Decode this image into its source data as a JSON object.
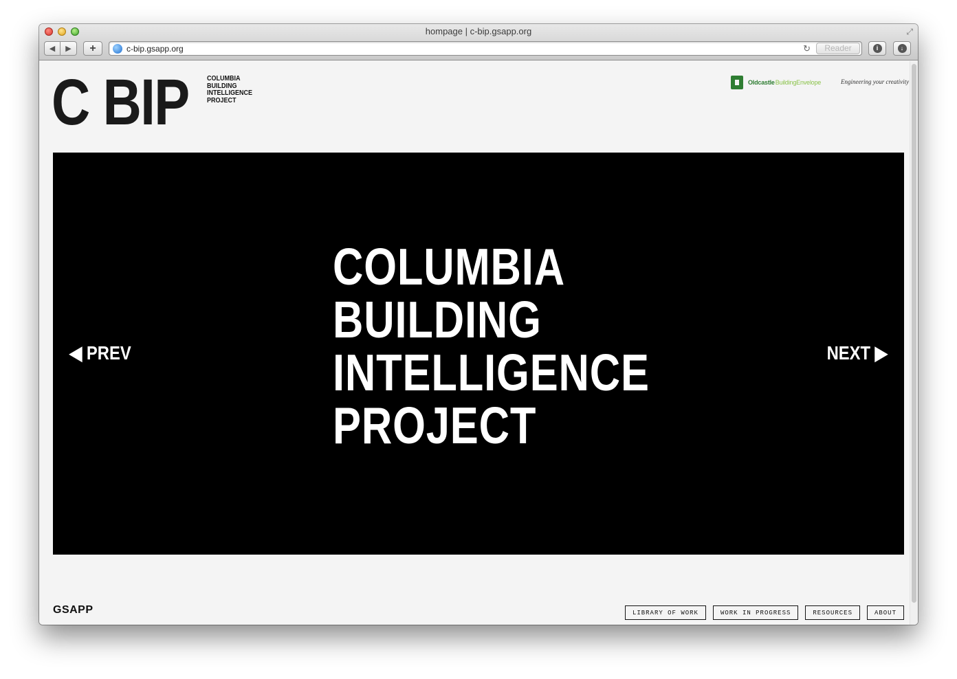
{
  "window": {
    "title": "hompage | c-bip.gsapp.org",
    "url": "c-bip.gsapp.org",
    "reader_label": "Reader"
  },
  "page": {
    "logo_big": "C BIP",
    "logo_small_lines": [
      "COLUMBIA",
      "BUILDING",
      "INTELLIGENCE",
      "PROJECT"
    ],
    "sponsor": {
      "name": "Oldcastle",
      "subname": "BuildingEnvelope",
      "tagline": "Engineering your creativity"
    },
    "hero": {
      "lines": [
        "COLUMBIA",
        "BUILDING",
        "INTELLIGENCE",
        "PROJECT"
      ],
      "prev_label": "◀ PREV",
      "next_label": "NEXT ▶"
    },
    "footer": {
      "brand": "GSAPP",
      "nav": [
        "LIBRARY OF WORK",
        "WORK IN PROGRESS",
        "RESOURCES",
        "ABOUT"
      ]
    }
  }
}
